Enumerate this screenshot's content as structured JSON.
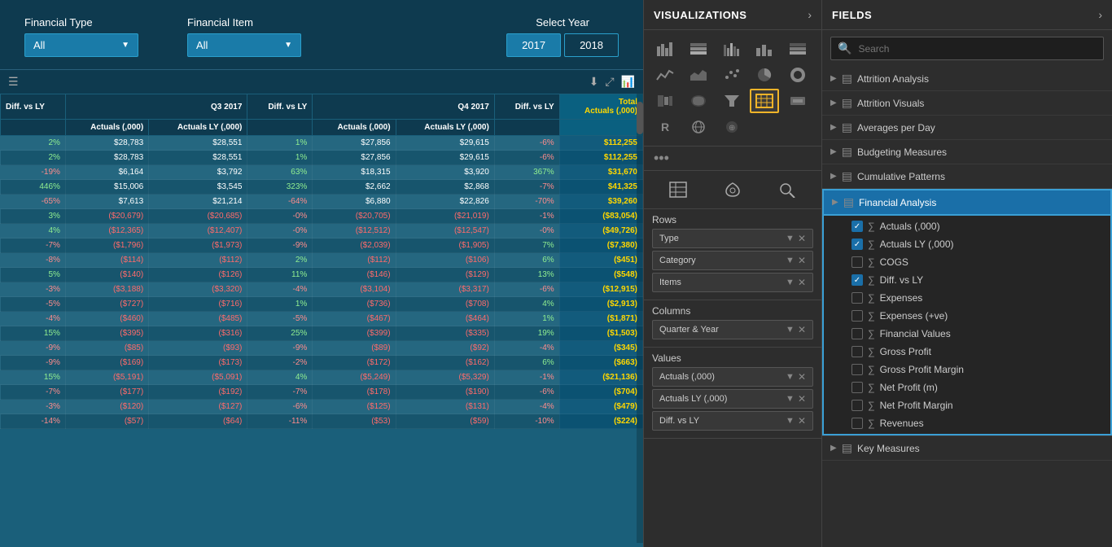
{
  "left": {
    "filters": {
      "financial_type": {
        "label": "Financial Type",
        "value": "All"
      },
      "financial_item": {
        "label": "Financial Item",
        "value": "All"
      },
      "select_year": {
        "label": "Select Year",
        "years": [
          "2017",
          "2018"
        ]
      }
    },
    "table": {
      "q3_header": "Q3 2017",
      "q4_header": "Q4 2017",
      "total_header": "Total",
      "col_actuals": "Actuals (,000)",
      "col_actuals_ly": "Actuals LY (,000)",
      "col_diff": "Diff. vs LY",
      "col_total_actuals": "Actuals (,000)",
      "rows": [
        {
          "diff0": "2%",
          "actuals_q3": "$28,783",
          "actuals_ly_q3": "$28,551",
          "diff_q3": "1%",
          "actuals_q4": "$27,856",
          "actuals_ly_q4": "$29,615",
          "diff_q4": "-6%",
          "total": "$112,255"
        },
        {
          "diff0": "2%",
          "actuals_q3": "$28,783",
          "actuals_ly_q3": "$28,551",
          "diff_q3": "1%",
          "actuals_q4": "$27,856",
          "actuals_ly_q4": "$29,615",
          "diff_q4": "-6%",
          "total": "$112,255"
        },
        {
          "diff0": "-19%",
          "actuals_q3": "$6,164",
          "actuals_ly_q3": "$3,792",
          "diff_q3": "63%",
          "actuals_q4": "$18,315",
          "actuals_ly_q4": "$3,920",
          "diff_q4": "367%",
          "total": "$31,670"
        },
        {
          "diff0": "446%",
          "actuals_q3": "$15,006",
          "actuals_ly_q3": "$3,545",
          "diff_q3": "323%",
          "actuals_q4": "$2,662",
          "actuals_ly_q4": "$2,868",
          "diff_q4": "-7%",
          "total": "$41,325"
        },
        {
          "diff0": "-65%",
          "actuals_q3": "$7,613",
          "actuals_ly_q3": "$21,214",
          "diff_q3": "-64%",
          "actuals_q4": "$6,880",
          "actuals_ly_q4": "$22,826",
          "diff_q4": "-70%",
          "total": "$39,260"
        },
        {
          "diff0": "3%",
          "actuals_q3": "($20,679)",
          "actuals_ly_q3": "($20,685)",
          "diff_q3": "-0%",
          "actuals_q4": "($20,705)",
          "actuals_ly_q4": "($21,019)",
          "diff_q4": "-1%",
          "total": "($83,054)"
        },
        {
          "diff0": "4%",
          "actuals_q3": "($12,365)",
          "actuals_ly_q3": "($12,407)",
          "diff_q3": "-0%",
          "actuals_q4": "($12,512)",
          "actuals_ly_q4": "($12,547)",
          "diff_q4": "-0%",
          "total": "($49,726)"
        },
        {
          "diff0": "-7%",
          "actuals_q3": "($1,796)",
          "actuals_ly_q3": "($1,973)",
          "diff_q3": "-9%",
          "actuals_q4": "($2,039)",
          "actuals_ly_q4": "($1,905)",
          "diff_q4": "7%",
          "total": "($7,380)"
        },
        {
          "diff0": "-8%",
          "actuals_q3": "($114)",
          "actuals_ly_q3": "($112)",
          "diff_q3": "2%",
          "actuals_q4": "($112)",
          "actuals_ly_q4": "($106)",
          "diff_q4": "6%",
          "total": "($451)"
        },
        {
          "diff0": "5%",
          "actuals_q3": "($140)",
          "actuals_ly_q3": "($126)",
          "diff_q3": "11%",
          "actuals_q4": "($146)",
          "actuals_ly_q4": "($129)",
          "diff_q4": "13%",
          "total": "($548)"
        },
        {
          "diff0": "-3%",
          "actuals_q3": "($3,188)",
          "actuals_ly_q3": "($3,320)",
          "diff_q3": "-4%",
          "actuals_q4": "($3,104)",
          "actuals_ly_q4": "($3,317)",
          "diff_q4": "-6%",
          "total": "($12,915)"
        },
        {
          "diff0": "-5%",
          "actuals_q3": "($727)",
          "actuals_ly_q3": "($716)",
          "diff_q3": "1%",
          "actuals_q4": "($736)",
          "actuals_ly_q4": "($708)",
          "diff_q4": "4%",
          "total": "($2,913)"
        },
        {
          "diff0": "-4%",
          "actuals_q3": "($460)",
          "actuals_ly_q3": "($485)",
          "diff_q3": "-5%",
          "actuals_q4": "($467)",
          "actuals_ly_q4": "($464)",
          "diff_q4": "1%",
          "total": "($1,871)"
        },
        {
          "diff0": "15%",
          "actuals_q3": "($395)",
          "actuals_ly_q3": "($316)",
          "diff_q3": "25%",
          "actuals_q4": "($399)",
          "actuals_ly_q4": "($335)",
          "diff_q4": "19%",
          "total": "($1,503)"
        },
        {
          "diff0": "-9%",
          "actuals_q3": "($85)",
          "actuals_ly_q3": "($93)",
          "diff_q3": "-9%",
          "actuals_q4": "($89)",
          "actuals_ly_q4": "($92)",
          "diff_q4": "-4%",
          "total": "($345)"
        },
        {
          "diff0": "-9%",
          "actuals_q3": "($169)",
          "actuals_ly_q3": "($173)",
          "diff_q3": "-2%",
          "actuals_q4": "($172)",
          "actuals_ly_q4": "($162)",
          "diff_q4": "6%",
          "total": "($663)"
        },
        {
          "diff0": "15%",
          "actuals_q3": "($5,191)",
          "actuals_ly_q3": "($5,091)",
          "diff_q3": "4%",
          "actuals_q4": "($5,249)",
          "actuals_ly_q4": "($5,329)",
          "diff_q4": "-1%",
          "total": "($21,136)"
        },
        {
          "diff0": "-7%",
          "actuals_q3": "($177)",
          "actuals_ly_q3": "($192)",
          "diff_q3": "-7%",
          "actuals_q4": "($178)",
          "actuals_ly_q4": "($190)",
          "diff_q4": "-6%",
          "total": "($704)"
        },
        {
          "diff0": "-3%",
          "actuals_q3": "($120)",
          "actuals_ly_q3": "($127)",
          "diff_q3": "-6%",
          "actuals_q4": "($125)",
          "actuals_ly_q4": "($131)",
          "diff_q4": "-4%",
          "total": "($479)"
        },
        {
          "diff0": "-14%",
          "actuals_q3": "($57)",
          "actuals_ly_q3": "($64)",
          "diff_q3": "-11%",
          "actuals_q4": "($53)",
          "actuals_ly_q4": "($59)",
          "diff_q4": "-10%",
          "total": "($224)"
        }
      ]
    }
  },
  "visualizations": {
    "title": "VISUALIZATIONS",
    "arrow": "›",
    "icons": [
      {
        "name": "bar-chart-icon",
        "symbol": "▦"
      },
      {
        "name": "grouped-bar-icon",
        "symbol": "▥"
      },
      {
        "name": "stacked-bar-icon",
        "symbol": "▤"
      },
      {
        "name": "column-chart-icon",
        "symbol": "▧"
      },
      {
        "name": "stacked-column-icon",
        "symbol": "▨"
      },
      {
        "name": "line-chart-icon",
        "symbol": "📈"
      },
      {
        "name": "area-chart-icon",
        "symbol": "📉"
      },
      {
        "name": "scatter-icon",
        "symbol": "⠿"
      },
      {
        "name": "pie-chart-icon",
        "symbol": "◕"
      },
      {
        "name": "donut-icon",
        "symbol": "◎"
      },
      {
        "name": "treemap-icon",
        "symbol": "▦"
      },
      {
        "name": "map-icon",
        "symbol": "🗺"
      },
      {
        "name": "gauge-icon",
        "symbol": "⊙"
      },
      {
        "name": "table-icon",
        "symbol": "⊞"
      },
      {
        "name": "matrix-icon",
        "symbol": "☰"
      },
      {
        "name": "card-icon",
        "symbol": "▭"
      },
      {
        "name": "r-script-icon",
        "symbol": "R"
      },
      {
        "name": "globe-icon",
        "symbol": "🌐"
      },
      {
        "name": "more-icon",
        "symbol": "•••"
      }
    ],
    "actions": [
      {
        "name": "fields-action-icon",
        "symbol": "▤"
      },
      {
        "name": "format-action-icon",
        "symbol": "🖌"
      },
      {
        "name": "analytics-action-icon",
        "symbol": "🔍"
      }
    ],
    "sections": {
      "rows": {
        "label": "Rows",
        "items": [
          {
            "label": "Type",
            "hasRemove": true
          },
          {
            "label": "Category",
            "hasRemove": true
          },
          {
            "label": "Items",
            "hasRemove": true
          }
        ]
      },
      "columns": {
        "label": "Columns",
        "items": [
          {
            "label": "Quarter & Year",
            "hasRemove": true
          }
        ]
      },
      "values": {
        "label": "Values",
        "items": [
          {
            "label": "Actuals (,000)",
            "hasRemove": true
          },
          {
            "label": "Actuals LY (,000)",
            "hasRemove": true
          },
          {
            "label": "Diff. vs LY",
            "hasRemove": true
          }
        ]
      }
    }
  },
  "fields": {
    "title": "FIELDS",
    "arrow": "›",
    "search": {
      "placeholder": "Search",
      "icon": "🔍"
    },
    "groups": [
      {
        "name": "Attrition Analysis",
        "expanded": false,
        "icon": "▤"
      },
      {
        "name": "Attrition Visuals",
        "expanded": false,
        "icon": "▤"
      },
      {
        "name": "Averages per Day",
        "expanded": false,
        "icon": "▤"
      },
      {
        "name": "Budgeting Measures",
        "expanded": false,
        "icon": "▤"
      },
      {
        "name": "Cumulative Patterns",
        "expanded": false,
        "icon": "▤"
      },
      {
        "name": "Financial Analysis",
        "expanded": true,
        "icon": "▤",
        "items": [
          {
            "label": "Actuals (,000)",
            "checked": true,
            "sigma": true
          },
          {
            "label": "Actuals LY (,000)",
            "checked": true,
            "sigma": true
          },
          {
            "label": "COGS",
            "checked": false,
            "sigma": true
          },
          {
            "label": "Diff. vs LY",
            "checked": true,
            "sigma": true
          },
          {
            "label": "Expenses",
            "checked": false,
            "sigma": true
          },
          {
            "label": "Expenses (+ve)",
            "checked": false,
            "sigma": true
          },
          {
            "label": "Financial Values",
            "checked": false,
            "sigma": true
          },
          {
            "label": "Gross Profit",
            "checked": false,
            "sigma": true
          },
          {
            "label": "Gross Profit Margin",
            "checked": false,
            "sigma": true
          },
          {
            "label": "Net Profit (m)",
            "checked": false,
            "sigma": true
          },
          {
            "label": "Net Profit Margin",
            "checked": false,
            "sigma": true
          },
          {
            "label": "Revenues",
            "checked": false,
            "sigma": true
          }
        ]
      },
      {
        "name": "Key Measures",
        "expanded": false,
        "icon": "▤"
      }
    ]
  }
}
